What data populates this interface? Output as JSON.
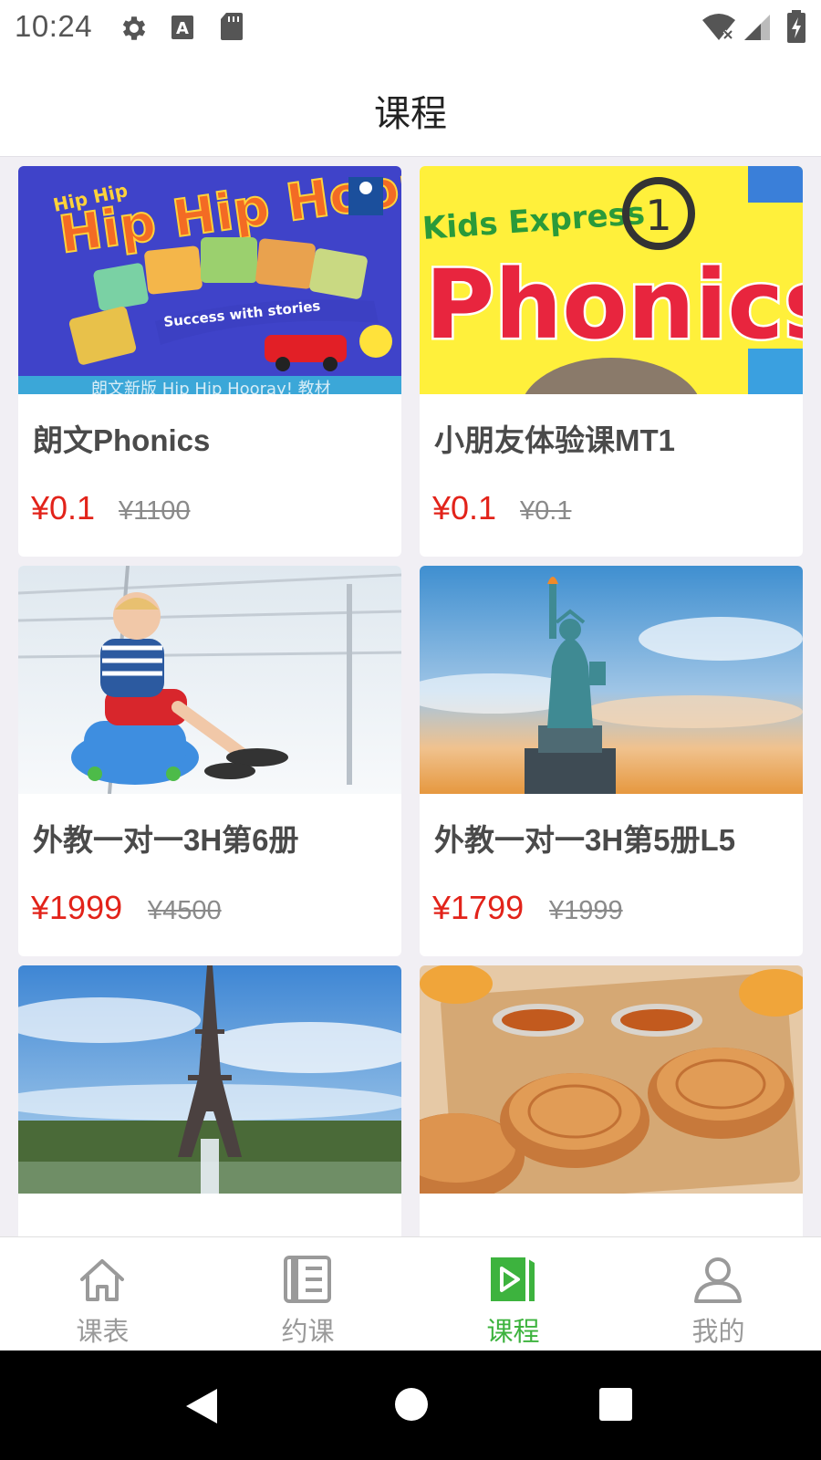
{
  "status_bar": {
    "time": "10:24"
  },
  "header": {
    "title": "课程"
  },
  "courses": [
    {
      "name": "朗文Phonics",
      "price": "¥0.1",
      "original_price": "¥1100",
      "thumbnail": "hip-hip-hooray-book-cover",
      "cover_text": "Hip Hip Hooray!",
      "cover_tagline": "Success with stories",
      "cover_banner": "朗文新版 Hip Hip Hooray! 教材"
    },
    {
      "name": "小朋友体验课MT1",
      "price": "¥0.1",
      "original_price": "¥0.1",
      "thumbnail": "kids-express-phonics-cover",
      "cover_text": "Phonics",
      "cover_subtext": "Kids Express",
      "cover_number": "1"
    },
    {
      "name": "外教一对一3H第6册",
      "price": "¥1999",
      "original_price": "¥4500",
      "thumbnail": "boy-on-suitcase-photo"
    },
    {
      "name": "外教一对一3H第5册L5",
      "price": "¥1799",
      "original_price": "¥1999",
      "thumbnail": "statue-of-liberty-photo"
    },
    {
      "name": "",
      "price": "",
      "original_price": "",
      "thumbnail": "eiffel-tower-photo"
    },
    {
      "name": "",
      "price": "",
      "original_price": "",
      "thumbnail": "mooncakes-tea-photo"
    }
  ],
  "tabbar": {
    "items": [
      {
        "label": "课表",
        "icon": "home-icon",
        "active": false
      },
      {
        "label": "约课",
        "icon": "notebook-icon",
        "active": false
      },
      {
        "label": "课程",
        "icon": "course-play-icon",
        "active": true
      },
      {
        "label": "我的",
        "icon": "user-icon",
        "active": false
      }
    ]
  },
  "colors": {
    "price": "#e2231a",
    "active_tab": "#3db33e",
    "inactive_tab": "#9a9a9a",
    "background": "#f1eff4"
  }
}
